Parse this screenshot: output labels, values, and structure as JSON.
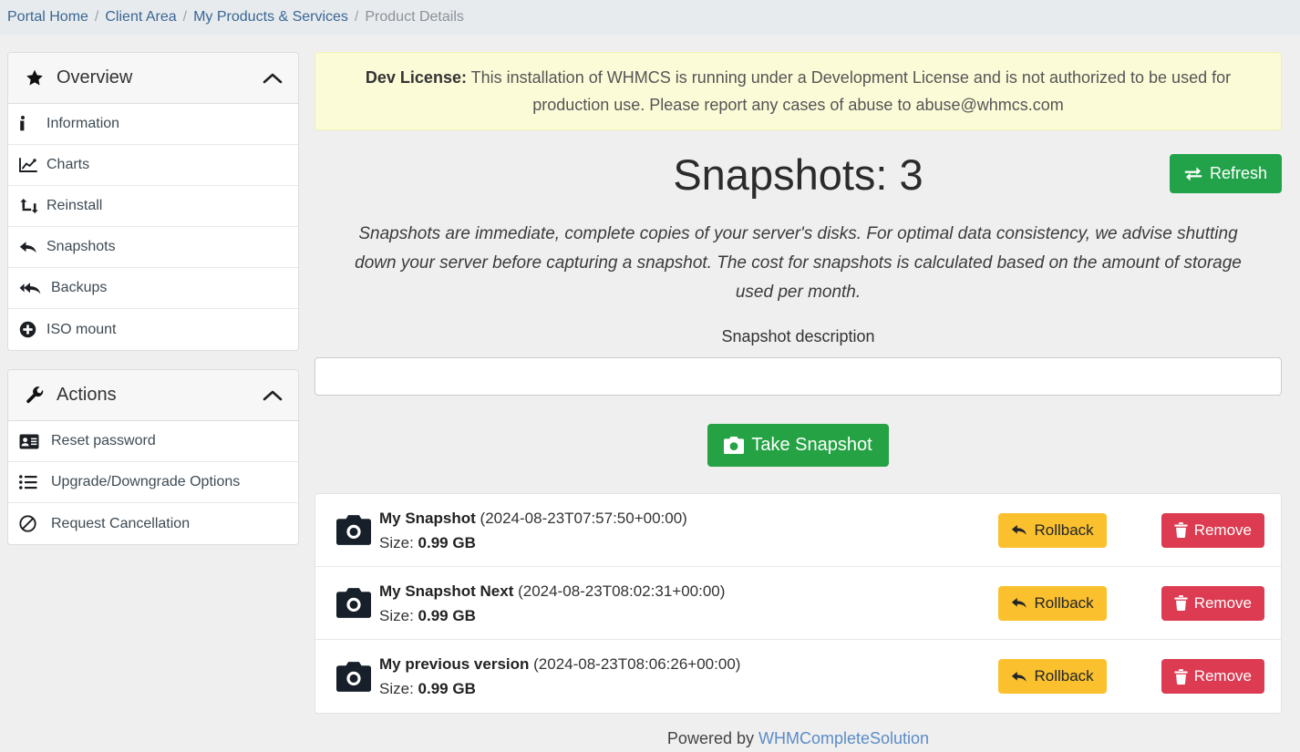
{
  "breadcrumb": {
    "items": [
      {
        "label": "Portal Home",
        "current": false
      },
      {
        "label": "Client Area",
        "current": false
      },
      {
        "label": "My Products & Services",
        "current": false
      },
      {
        "label": "Product Details",
        "current": true
      }
    ],
    "separator": "/"
  },
  "sidebar": {
    "panels": [
      {
        "title": "Overview",
        "icon": "star-icon",
        "caret": "chevron-up-icon",
        "items": [
          {
            "label": "Information",
            "icon": "info-icon"
          },
          {
            "label": "Charts",
            "icon": "chart-line-icon"
          },
          {
            "label": "Reinstall",
            "icon": "retweet-icon"
          },
          {
            "label": "Snapshots",
            "icon": "reply-icon"
          },
          {
            "label": "Backups",
            "icon": "reply-all-icon"
          },
          {
            "label": "ISO mount",
            "icon": "plus-circle-icon"
          }
        ]
      },
      {
        "title": "Actions",
        "icon": "wrench-icon",
        "caret": "chevron-up-icon",
        "items": [
          {
            "label": "Reset password",
            "icon": "id-card-icon"
          },
          {
            "label": "Upgrade/Downgrade Options",
            "icon": "list-icon"
          },
          {
            "label": "Request Cancellation",
            "icon": "ban-icon"
          }
        ]
      }
    ]
  },
  "alert": {
    "strong": "Dev License:",
    "text": " This installation of WHMCS is running under a Development License and is not authorized to be used for production use. Please report any cases of abuse to abuse@whmcs.com"
  },
  "main": {
    "title": "Snapshots: 3",
    "refresh_label": "Refresh",
    "refresh_icon": "exchange-icon",
    "intro": "Snapshots are immediate, complete copies of your server's disks. For optimal data consistency, we advise shutting down your server before capturing a snapshot. The cost for snapshots is calculated based on the amount of storage used per month.",
    "description_label": "Snapshot description",
    "description_value": "",
    "description_placeholder": "",
    "take_snapshot_label": "Take Snapshot",
    "take_snapshot_icon": "camera-icon"
  },
  "snapshots": {
    "row_icon": "camera-icon",
    "rollback_label": "Rollback",
    "rollback_icon": "reply-icon",
    "remove_label": "Remove",
    "remove_icon": "trash-icon",
    "size_label": "Size:",
    "items": [
      {
        "name": "My Snapshot",
        "date": "(2024-08-23T07:57:50+00:00)",
        "size": "0.99 GB"
      },
      {
        "name": "My Snapshot Next",
        "date": "(2024-08-23T08:02:31+00:00)",
        "size": "0.99 GB"
      },
      {
        "name": "My previous version",
        "date": "(2024-08-23T08:06:26+00:00)",
        "size": "0.99 GB"
      }
    ]
  },
  "footer": {
    "prefix": "Powered by ",
    "link": "WHMCompleteSolution"
  },
  "colors": {
    "accent_green": "#25a244",
    "warning_yellow": "#fbc02d",
    "danger_red": "#dc3b51",
    "alert_bg": "#fcfbd8",
    "link_blue": "#3a6694"
  }
}
